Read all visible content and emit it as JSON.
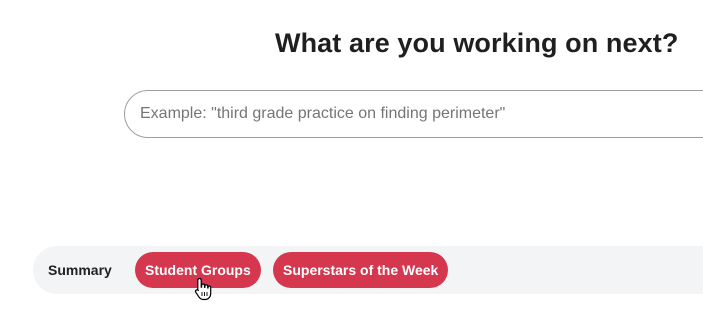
{
  "header": {
    "title": "What are you working on next?"
  },
  "search": {
    "placeholder": "Example: \"third grade practice on finding perimeter\"",
    "value": ""
  },
  "tabs": [
    {
      "label": "Summary",
      "active": false
    },
    {
      "label": "Student Groups",
      "active": true
    },
    {
      "label": "Superstars of the Week",
      "active": true
    }
  ],
  "colors": {
    "accent": "#d4374e",
    "tab_bar_bg": "#f3f4f6",
    "heading": "#1f1f1f"
  },
  "cursor": {
    "icon": "hand-pointer-icon"
  }
}
